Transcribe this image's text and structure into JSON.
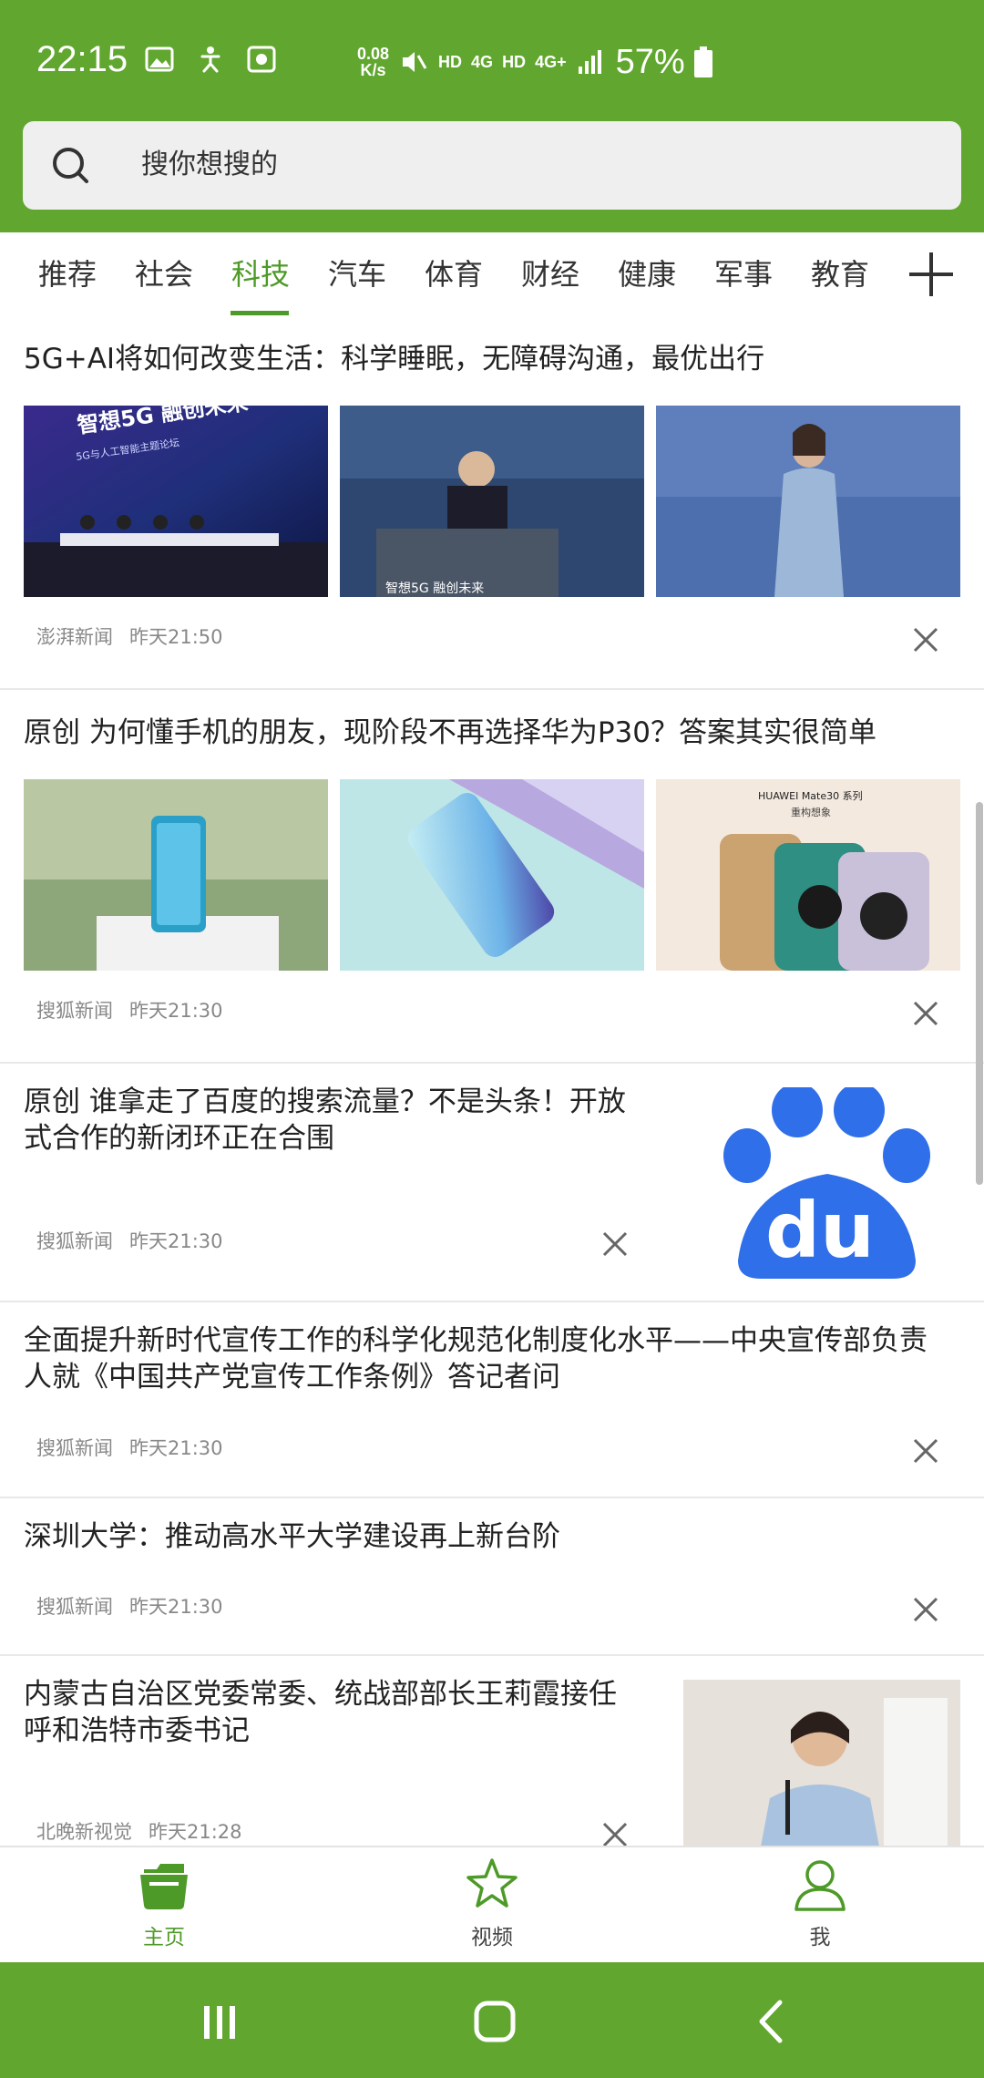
{
  "status_bar": {
    "time": "22:15",
    "net_speed_value": "0.08",
    "net_speed_unit": "K/s",
    "hd1": "HD",
    "net1": "4G",
    "hd2": "HD",
    "net2": "4G+",
    "battery": "57%",
    "icons": [
      "image-icon",
      "accessibility-icon",
      "screen-record-icon",
      "mute-icon",
      "signal-icon",
      "battery-icon"
    ]
  },
  "search": {
    "placeholder": "搜你想搜的"
  },
  "tabs": [
    {
      "label": "推荐"
    },
    {
      "label": "社会"
    },
    {
      "label": "科技",
      "active": true
    },
    {
      "label": "汽车"
    },
    {
      "label": "体育"
    },
    {
      "label": "财经"
    },
    {
      "label": "健康"
    },
    {
      "label": "军事"
    },
    {
      "label": "教育"
    }
  ],
  "articles": [
    {
      "title": "5G+AI将如何改变生活：科学睡眠，无障碍沟通，最优出行",
      "source": "澎湃新闻",
      "time": "昨天21:50",
      "image_texts": [
        "智想5G  融创未来",
        "5G与人工智能主题论坛",
        "智想5G 融创未来"
      ]
    },
    {
      "title": "原创 为何懂手机的朋友，现阶段不再选择华为P30？答案其实很简单",
      "source": "搜狐新闻",
      "time": "昨天21:30",
      "image_texts": [
        "HUAWEI Mate30 系列",
        "重构想象"
      ]
    },
    {
      "title_line1": "原创 谁拿走了百度的搜索流量？不是头条！开放",
      "title_line2": "式合作的新闭环正在合围",
      "source": "搜狐新闻",
      "time": "昨天21:30",
      "logo_text": "du"
    },
    {
      "title_line1": "全面提升新时代宣传工作的科学化规范化制度化水平——中央宣传部负责",
      "title_line2": "人就《中国共产党宣传工作条例》答记者问",
      "source": "搜狐新闻",
      "time": "昨天21:30"
    },
    {
      "title": "深圳大学：推动高水平大学建设再上新台阶",
      "source": "搜狐新闻",
      "time": "昨天21:30"
    },
    {
      "title_line1": "内蒙古自治区党委常委、统战部部长王莉霞接任",
      "title_line2": "呼和浩特市委书记",
      "source": "北晚新视觉",
      "time": "昨天21:28"
    }
  ],
  "bottom_nav": [
    {
      "label": "主页",
      "icon": "home-folder-icon",
      "active": true
    },
    {
      "label": "视频",
      "icon": "star-icon"
    },
    {
      "label": "我",
      "icon": "person-icon"
    }
  ],
  "system_nav": {
    "buttons": [
      "recents-icon",
      "home-icon",
      "back-icon"
    ]
  },
  "colors": {
    "brand_green": "#61a72f",
    "active_green": "#4e9a28",
    "meta_gray": "#888888"
  }
}
